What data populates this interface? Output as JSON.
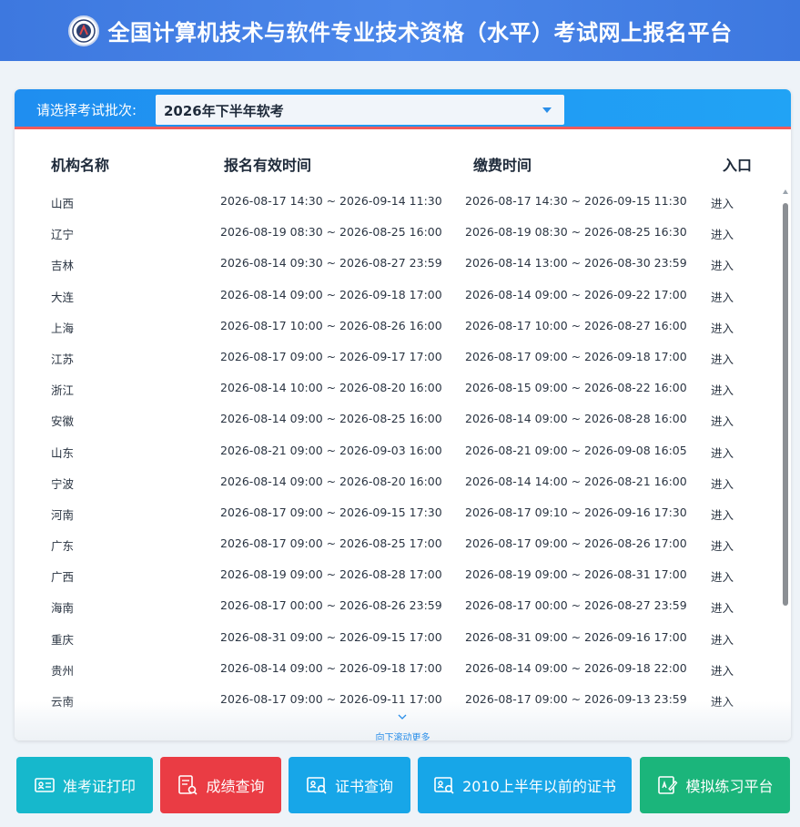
{
  "header": {
    "title": "全国计算机技术与软件专业技术资格（水平）考试网上报名平台"
  },
  "selector": {
    "label": "请选择考试批次:",
    "value": "2026年下半年软考"
  },
  "table": {
    "columns": [
      "机构名称",
      "报名有效时间",
      "缴费时间",
      "入口"
    ],
    "rows": [
      {
        "name": "山西",
        "reg": "2026-08-17 14:30 ~ 2026-09-14 11:30",
        "pay": "2026-08-17 14:30 ~ 2026-09-15 11:30",
        "enter": "进入"
      },
      {
        "name": "辽宁",
        "reg": "2026-08-19 08:30 ~ 2026-08-25 16:00",
        "pay": "2026-08-19 08:30 ~ 2026-08-25 16:30",
        "enter": "进入"
      },
      {
        "name": "吉林",
        "reg": "2026-08-14 09:30 ~ 2026-08-27 23:59",
        "pay": "2026-08-14 13:00 ~ 2026-08-30 23:59",
        "enter": "进入"
      },
      {
        "name": "大连",
        "reg": "2026-08-14 09:00 ~ 2026-09-18 17:00",
        "pay": "2026-08-14 09:00 ~ 2026-09-22 17:00",
        "enter": "进入"
      },
      {
        "name": "上海",
        "reg": "2026-08-17 10:00 ~ 2026-08-26 16:00",
        "pay": "2026-08-17 10:00 ~ 2026-08-27 16:00",
        "enter": "进入"
      },
      {
        "name": "江苏",
        "reg": "2026-08-17 09:00 ~ 2026-09-17 17:00",
        "pay": "2026-08-17 09:00 ~ 2026-09-18 17:00",
        "enter": "进入"
      },
      {
        "name": "浙江",
        "reg": "2026-08-14 10:00 ~ 2026-08-20 16:00",
        "pay": "2026-08-15 09:00 ~ 2026-08-22 16:00",
        "enter": "进入"
      },
      {
        "name": "安徽",
        "reg": "2026-08-14 09:00 ~ 2026-08-25 16:00",
        "pay": "2026-08-14 09:00 ~ 2026-08-28 16:00",
        "enter": "进入"
      },
      {
        "name": "山东",
        "reg": "2026-08-21 09:00 ~ 2026-09-03 16:00",
        "pay": "2026-08-21 09:00 ~ 2026-09-08 16:05",
        "enter": "进入"
      },
      {
        "name": "宁波",
        "reg": "2026-08-14 09:00 ~ 2026-08-20 16:00",
        "pay": "2026-08-14 14:00 ~ 2026-08-21 16:00",
        "enter": "进入"
      },
      {
        "name": "河南",
        "reg": "2026-08-17 09:00 ~ 2026-09-15 17:30",
        "pay": "2026-08-17 09:10 ~ 2026-09-16 17:30",
        "enter": "进入"
      },
      {
        "name": "广东",
        "reg": "2026-08-17 09:00 ~ 2026-08-25 17:00",
        "pay": "2026-08-17 09:00 ~ 2026-08-26 17:00",
        "enter": "进入"
      },
      {
        "name": "广西",
        "reg": "2026-08-19 09:00 ~ 2026-08-28 17:00",
        "pay": "2026-08-19 09:00 ~ 2026-08-31 17:00",
        "enter": "进入"
      },
      {
        "name": "海南",
        "reg": "2026-08-17 00:00 ~ 2026-08-26 23:59",
        "pay": "2026-08-17 00:00 ~ 2026-08-27 23:59",
        "enter": "进入"
      },
      {
        "name": "重庆",
        "reg": "2026-08-31 09:00 ~ 2026-09-15 17:00",
        "pay": "2026-08-31 09:00 ~ 2026-09-16 17:00",
        "enter": "进入"
      },
      {
        "name": "贵州",
        "reg": "2026-08-14 09:00 ~ 2026-09-18 17:00",
        "pay": "2026-08-14 09:00 ~ 2026-09-18 22:00",
        "enter": "进入"
      },
      {
        "name": "云南",
        "reg": "2026-08-17 09:00 ~ 2026-09-11 17:00",
        "pay": "2026-08-17 09:00 ~ 2026-09-13 23:59",
        "enter": "进入"
      }
    ]
  },
  "scroll_hint": "向下滚动更多",
  "buttons": [
    {
      "label": "准考证打印",
      "icon": "id-card-icon"
    },
    {
      "label": "成绩查询",
      "icon": "report-search-icon"
    },
    {
      "label": "证书查询",
      "icon": "certificate-search-icon"
    },
    {
      "label": "2010上半年以前的证书",
      "icon": "certificate-search-icon"
    },
    {
      "label": "模拟练习平台",
      "icon": "practice-edit-icon"
    }
  ],
  "colors": {
    "header_blue": "#4b87ea",
    "bar_blue": "#1f8ef0",
    "accent_red": "#f05a5a",
    "btn_teal": "#16b8cc",
    "btn_red": "#ea3c44",
    "btn_blue": "#17a6e8",
    "btn_green": "#1bb57b"
  }
}
